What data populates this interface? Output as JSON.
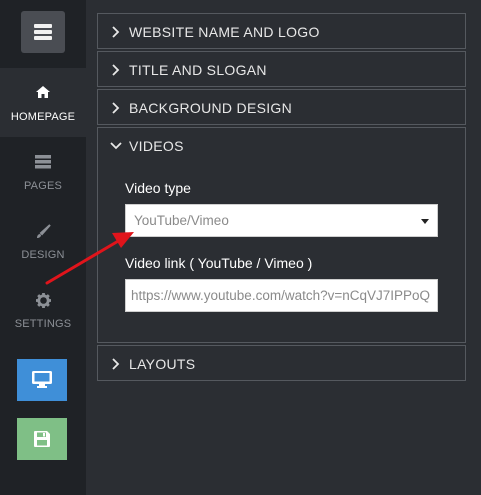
{
  "sidebar": {
    "items": [
      {
        "label": "HOMEPAGE",
        "icon": "home-icon",
        "active": true
      },
      {
        "label": "PAGES",
        "icon": "pages-icon",
        "active": false
      },
      {
        "label": "DESIGN",
        "icon": "brush-icon",
        "active": false
      },
      {
        "label": "SETTINGS",
        "icon": "gear-icon",
        "active": false
      }
    ],
    "preview_button": {
      "icon": "monitor-icon",
      "color": "#3f8fd8"
    },
    "save_button": {
      "icon": "save-icon",
      "color": "#7fbf86"
    }
  },
  "sections": [
    {
      "title": "WEBSITE NAME AND LOGO",
      "expanded": false
    },
    {
      "title": "TITLE AND SLOGAN",
      "expanded": false
    },
    {
      "title": "BACKGROUND DESIGN",
      "expanded": false
    },
    {
      "title": "VIDEOS",
      "expanded": true
    },
    {
      "title": "LAYOUTS",
      "expanded": false
    }
  ],
  "videos": {
    "video_type_label": "Video type",
    "video_type_value": "YouTube/Vimeo",
    "video_link_label": "Video link ( YouTube / Vimeo )",
    "video_link_value": "https://www.youtube.com/watch?v=nCqVJ7IPPoQ"
  },
  "colors": {
    "accent_blue": "#3f8fd8",
    "save_green": "#7fbf86",
    "annotation_arrow": "#e0141b"
  }
}
